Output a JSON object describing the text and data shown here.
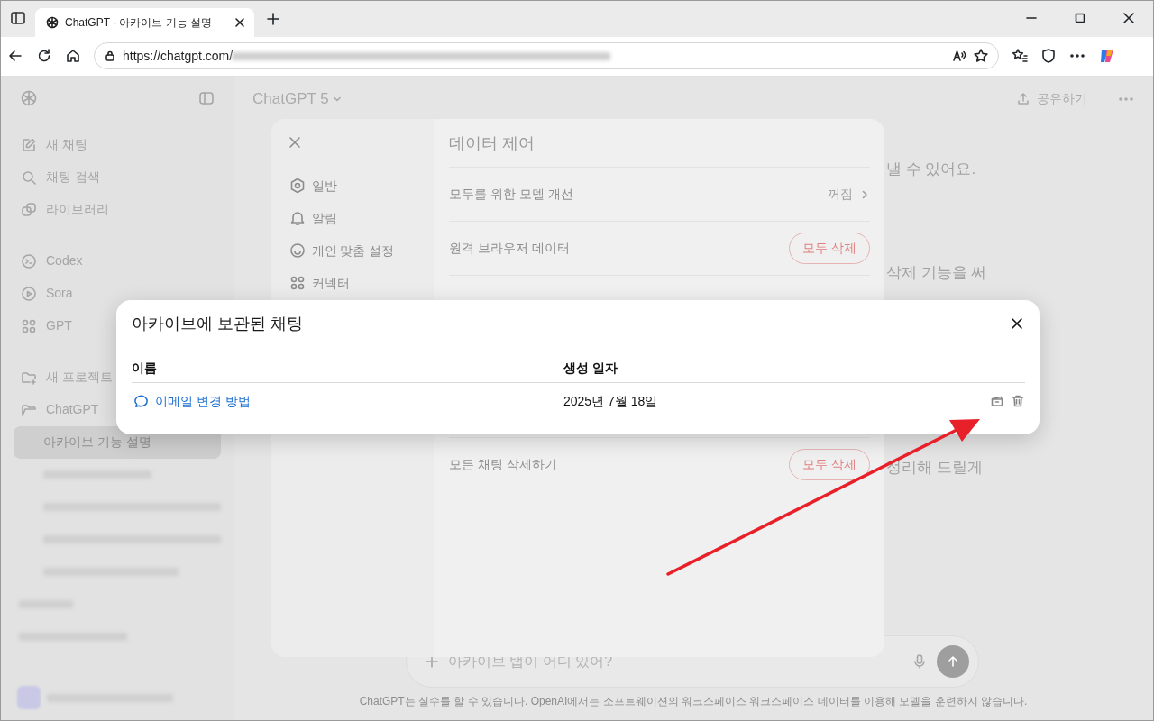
{
  "browser": {
    "tab_title": "ChatGPT - 아카이브 기능 설명",
    "url": "https://chatgpt.com/"
  },
  "sidebar": {
    "groups": [
      {
        "items": [
          {
            "kind": "nav",
            "label": "새 채팅",
            "selected": false
          },
          {
            "kind": "nav",
            "label": "채팅 검색",
            "selected": false
          },
          {
            "kind": "nav",
            "label": "라이브러리",
            "selected": false
          }
        ]
      },
      {
        "items": [
          {
            "kind": "nav",
            "label": "Codex",
            "selected": false
          },
          {
            "kind": "nav",
            "label": "Sora",
            "selected": false
          },
          {
            "kind": "nav",
            "label": "GPT",
            "selected": false
          }
        ]
      },
      {
        "items": [
          {
            "kind": "nav",
            "label": "새 프로젝트",
            "selected": false
          },
          {
            "kind": "nav",
            "label": "ChatGPT",
            "selected": false
          },
          {
            "kind": "chat",
            "label": "아카이브 기능 설명",
            "selected": true
          }
        ]
      }
    ]
  },
  "header": {
    "model": "ChatGPT 5",
    "share": "공유하기"
  },
  "conversation": {
    "fragments": [
      "낼 수 있어요.",
      "삭제 기능을 써",
      "정리해 드릴게"
    ]
  },
  "composer": {
    "value": "아카이브 탭이 어디 있어?"
  },
  "disclaimer": "ChatGPT는 실수를 할 수 있습니다. OpenAI에서는 소프트웨이션의 워크스페이스 워크스페이스 데이터를 이용해 모델을 훈련하지 않습니다.",
  "settings": {
    "title": "데이터 제어",
    "nav": [
      {
        "label": "일반",
        "selected": false
      },
      {
        "label": "알림",
        "selected": false
      },
      {
        "label": "개인 맞춤 설정",
        "selected": false
      },
      {
        "label": "커넥터",
        "selected": false
      }
    ],
    "rows": [
      {
        "kind": "link",
        "label": "모두를 위한 모델 개선",
        "value": "꺼짐"
      },
      {
        "kind": "danger",
        "label": "원격 브라우저 데이터",
        "button": "모두 삭제"
      },
      {
        "kind": "danger",
        "label": "모든 채팅 삭제하기",
        "button": "모두 삭제"
      }
    ]
  },
  "archive_dialog": {
    "title": "아카이브에 보관된 채팅",
    "columns": [
      "이름",
      "생성 일자"
    ],
    "rows": [
      {
        "name": "이메일 변경 방법",
        "date": "2025년 7월 18일"
      }
    ]
  }
}
